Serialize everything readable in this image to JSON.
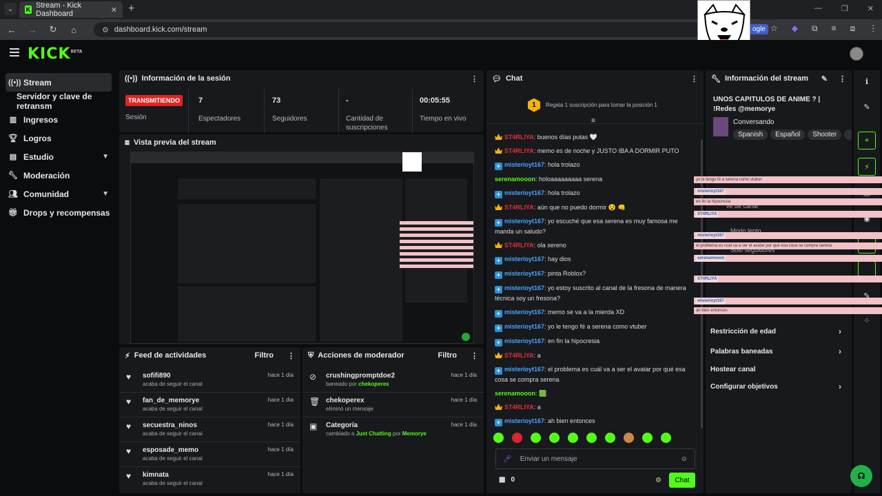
{
  "browser": {
    "tab_title": "Stream - Kick Dashboard",
    "url": "dashboard.kick.com/stream",
    "ext_text": "ogle"
  },
  "brand": {
    "logo": "KICK",
    "beta": "BETA",
    "accent": "#53fc18"
  },
  "sidebar": {
    "items": [
      {
        "label": "Stream",
        "icon": "broadcast-icon"
      },
      {
        "label": "Servidor y clave de retransm"
      },
      {
        "label": "Ingresos",
        "icon": "chart-icon"
      },
      {
        "label": "Logros",
        "icon": "trophy-icon"
      },
      {
        "label": "Estudio",
        "icon": "studio-icon"
      },
      {
        "label": "Moderación",
        "icon": "wrench-icon"
      },
      {
        "label": "Comunidad",
        "icon": "community-icon"
      },
      {
        "label": "Drops y recompensas",
        "icon": "gift-icon"
      }
    ]
  },
  "session": {
    "title": "Información de la sesión",
    "live_badge": "TRANSMITIENDO",
    "session_label": "Sesión",
    "stats": [
      {
        "value": "7",
        "label": "Espectadores"
      },
      {
        "value": "73",
        "label": "Seguidores"
      },
      {
        "value": "-",
        "label": "Cantidad de suscripciones"
      },
      {
        "value": "00:05:55",
        "label": "Tiempo en vivo"
      }
    ]
  },
  "preview": {
    "title": "Vista previa del stream"
  },
  "feed": {
    "title": "Feed de actividades",
    "filter": "Filtro",
    "rows": [
      {
        "name": "sofifi890",
        "sub": "acaba de seguir el canal",
        "time": "hace 1 día"
      },
      {
        "name": "fan_de_memorye",
        "sub": "acaba de seguir el canal",
        "time": "hace 1 día"
      },
      {
        "name": "secuestra_ninos",
        "sub": "acaba de seguir el canal",
        "time": "hace 1 día"
      },
      {
        "name": "esposade_memo",
        "sub": "acaba de seguir el canal",
        "time": "hace 1 día"
      },
      {
        "name": "kimnata",
        "sub": "acaba de seguir el canal",
        "time": "hace 1 día"
      }
    ]
  },
  "modactions": {
    "title": "Acciones de moderador",
    "filter": "Filtro",
    "rows": [
      {
        "name": "crushingpromptdoe2",
        "pre": "baneado por ",
        "by": "chekoperex",
        "time": "hace 1 día"
      },
      {
        "name": "chekoperex",
        "pre": "eliminó un mensaje",
        "time": "hace 1 día"
      },
      {
        "name": "Categoría",
        "pre": "cambiado a ",
        "cat": "Just Chatting",
        "mid": " por ",
        "by": "Memorye",
        "time": "hace 1 día"
      }
    ]
  },
  "chat": {
    "title": "Chat",
    "gift_rank": "1",
    "gift_text": "Regala 1 suscripción para tomar la posición 1",
    "messages": [
      {
        "user": "ST4RLIYA",
        "badge": "crown",
        "color": "#e0313a",
        "text": ": buenos días putas 🤍"
      },
      {
        "user": "ST4RLIYA",
        "badge": "crown",
        "color": "#e0313a",
        "text": ": memo es de noche y JUSTO IBA A DORMIR PUTO"
      },
      {
        "user": "misterioyt167",
        "badge": "vip",
        "color": "#4aa3ff",
        "text": ": hola trolazo"
      },
      {
        "user": "serenamooon",
        "badge": "",
        "color": "#53fc18",
        "text": ": holoaaaaaaaaa serena"
      },
      {
        "user": "misterioyt167",
        "badge": "vip",
        "color": "#4aa3ff",
        "text": ": hola trolazo"
      },
      {
        "user": "ST4RLIYA",
        "badge": "crown",
        "color": "#e0313a",
        "text": ": aún que no puedo dormir 😵 👊"
      },
      {
        "user": "misterioyt167",
        "badge": "vip",
        "color": "#4aa3ff",
        "text": ": yo escuché que esa serena es muy famosa me manda un saludo?"
      },
      {
        "user": "ST4RLIYA",
        "badge": "crown",
        "color": "#e0313a",
        "text": ": ola sereno"
      },
      {
        "user": "misterioyt167",
        "badge": "vip",
        "color": "#4aa3ff",
        "text": ": hay dios"
      },
      {
        "user": "misterioyt167",
        "badge": "vip",
        "color": "#4aa3ff",
        "text": ": pinta Roblox?"
      },
      {
        "user": "misterioyt167",
        "badge": "vip",
        "color": "#4aa3ff",
        "text": ": yo estoy suscrito al canal de la fresona de manera técnica soy un fresona?"
      },
      {
        "user": "misterioyt167",
        "badge": "vip",
        "color": "#4aa3ff",
        "text": ": memo se va a la mierda XD"
      },
      {
        "user": "misterioyt167",
        "badge": "vip",
        "color": "#4aa3ff",
        "text": ": yo le tengo fé a serena como vtuber"
      },
      {
        "user": "misterioyt167",
        "badge": "vip",
        "color": "#4aa3ff",
        "text": ": en fin la hipocresia"
      },
      {
        "user": "ST4RLIYA",
        "badge": "crown",
        "color": "#e0313a",
        "text": ": a"
      },
      {
        "user": "misterioyt167",
        "badge": "vip",
        "color": "#4aa3ff",
        "text": ": el problema es cuál va a ser el avatar por qué esa cosa se compra serena"
      },
      {
        "user": "serenamooon",
        "badge": "",
        "color": "#53fc18",
        "text": ": 🟩"
      },
      {
        "user": "ST4RLIYA",
        "badge": "crown",
        "color": "#e0313a",
        "text": ": a"
      },
      {
        "user": "misterioyt167",
        "badge": "vip",
        "color": "#4aa3ff",
        "text": ": ah bien entonces"
      }
    ],
    "input_placeholder": "Enviar un mensaje",
    "points": "0",
    "send": "Chat"
  },
  "overlay_chat": [
    "yo le tengo fé a serena como vtuber",
    "misterioyt167",
    "en fin la hipocresia",
    "ST4RLIYA",
    "misterioyt167",
    "el problema es cuál va a ser el avatar por qué esa cosa se compra serena",
    "serenamooon",
    "ST4RLIYA",
    "misterioyt167",
    "ah bien entonces"
  ],
  "streaminfo": {
    "title": "Información del stream",
    "stream_title": "UNOS CAPITULOS DE ANIME ? | !Redes @memorye",
    "category": "Conversando",
    "tags": [
      "Spanish",
      "Español",
      "Shooter"
    ],
    "menu": [
      "Restricción de edad",
      "Palabras baneadas",
      "Hostear canal",
      "Configurar objetivos"
    ],
    "partial": [
      "ve de canal",
      "Modo lento",
      "Solo seguidores"
    ]
  }
}
